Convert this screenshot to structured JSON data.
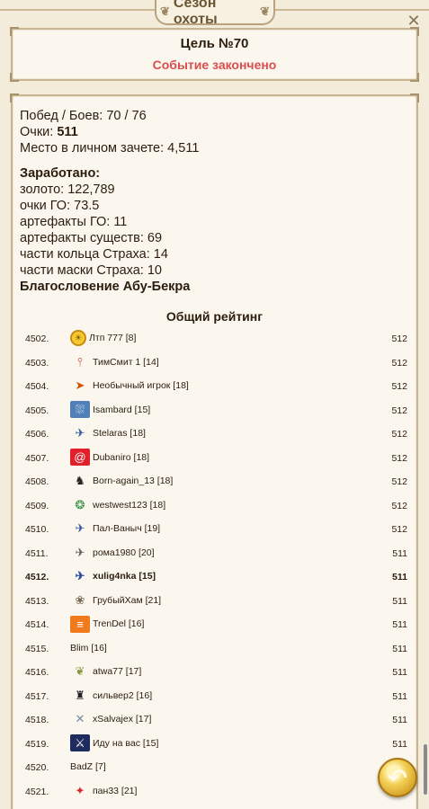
{
  "header": {
    "title": "Сезон охоты",
    "close_icon": "close-icon"
  },
  "goal": {
    "title": "Цель №70",
    "status": "Событие закончено"
  },
  "stats": {
    "wins_battles": "Побед / Боев: 70 / 76",
    "points_label": "Очки: ",
    "points_value": "511",
    "place": "Место в личном зачете: 4,511",
    "earned_title": "Заработано:",
    "gold": "золото: 122,789",
    "go_points": "очки ГО: 73.5",
    "go_artifacts": "артефакты ГО: 11",
    "creature_artifacts": "артефакты существ: 69",
    "ring_parts": "части кольца Страха: 14",
    "mask_parts": "части маски Страха: 10",
    "blessing": "Благословение Абу-Бекра"
  },
  "rating": {
    "title": "Общий рейтинг",
    "rows": [
      {
        "pos": "4502.",
        "name": "Лтп 777 [8]",
        "score": "512",
        "icon": "gold-coin-icon",
        "glyph": "☀",
        "bg": "",
        "fg": "#8a5500"
      },
      {
        "pos": "4503.",
        "name": "ТимСмит 1 [14]",
        "score": "512",
        "icon": "torch-icon",
        "glyph": "⫯",
        "bg": "",
        "fg": "#c0392b"
      },
      {
        "pos": "4504.",
        "name": "Необычный игрок [18]",
        "score": "512",
        "icon": "phoenix-icon",
        "glyph": "➤",
        "bg": "",
        "fg": "#d35400"
      },
      {
        "pos": "4505.",
        "name": "Isambard [15]",
        "score": "512",
        "icon": "blue-banner-icon",
        "glyph": "⛆",
        "bg": "#4f81b8",
        "fg": "#ffffff"
      },
      {
        "pos": "4506.",
        "name": "Stelaras [18]",
        "score": "512",
        "icon": "eagle-icon",
        "glyph": "✈",
        "bg": "",
        "fg": "#2b4f9e"
      },
      {
        "pos": "4507.",
        "name": "Dubaniro [18]",
        "score": "512",
        "icon": "at-sign-icon",
        "glyph": "@",
        "bg": "#e0202a",
        "fg": "#ffffff"
      },
      {
        "pos": "4508.",
        "name": "Born-again_13 [18]",
        "score": "512",
        "icon": "black-eagle-icon",
        "glyph": "♞",
        "bg": "",
        "fg": "#222222"
      },
      {
        "pos": "4509.",
        "name": "westwest123 [18]",
        "score": "512",
        "icon": "green-dragon-icon",
        "glyph": "❂",
        "bg": "",
        "fg": "#2e8b3a"
      },
      {
        "pos": "4510.",
        "name": "Пал-Ваныч [19]",
        "score": "512",
        "icon": "eagle-icon",
        "glyph": "✈",
        "bg": "",
        "fg": "#2b4f9e"
      },
      {
        "pos": "4511.",
        "name": "рома1980 [20]",
        "score": "511",
        "icon": "bird-icon",
        "glyph": "✈",
        "bg": "",
        "fg": "#555555"
      },
      {
        "pos": "4512.",
        "name": "xulig4nka [15]",
        "score": "511",
        "icon": "eagle-icon",
        "glyph": "✈",
        "bg": "",
        "fg": "#2b4f9e",
        "me": true
      },
      {
        "pos": "4513.",
        "name": "ГрубыйХам [21]",
        "score": "511",
        "icon": "cat-icon",
        "glyph": "❀",
        "bg": "",
        "fg": "#7a6a55"
      },
      {
        "pos": "4514.",
        "name": "TrenDel [16]",
        "score": "511",
        "icon": "orange-banner-icon",
        "glyph": "≡",
        "bg": "#f07a1e",
        "fg": "#ffffff"
      },
      {
        "pos": "4515.",
        "name": "Blim [16]",
        "score": "511",
        "icon": "",
        "glyph": "",
        "bg": "",
        "fg": ""
      },
      {
        "pos": "4516.",
        "name": "atwa77 [17]",
        "score": "511",
        "icon": "wings-icon",
        "glyph": "❦",
        "bg": "",
        "fg": "#8a9a4a"
      },
      {
        "pos": "4517.",
        "name": "сильвер2 [16]",
        "score": "511",
        "icon": "knights-icon",
        "glyph": "♜",
        "bg": "",
        "fg": "#222222"
      },
      {
        "pos": "4518.",
        "name": "xSalvajex [17]",
        "score": "511",
        "icon": "crossed-swords-icon",
        "glyph": "✕",
        "bg": "",
        "fg": "#7a8ba8"
      },
      {
        "pos": "4519.",
        "name": "Иду на вас [15]",
        "score": "511",
        "icon": "swords-icon",
        "glyph": "⚔",
        "bg": "#1d2b5e",
        "fg": "#ffffff"
      },
      {
        "pos": "4520.",
        "name": "BadZ [7]",
        "score": "511",
        "icon": "",
        "glyph": "",
        "bg": "",
        "fg": ""
      },
      {
        "pos": "4521.",
        "name": "пан33 [21]",
        "score": "511",
        "icon": "red-cross-icon",
        "glyph": "✦",
        "bg": "",
        "fg": "#d42a2a"
      }
    ]
  },
  "controls": {
    "back_icon": "back-arrow-icon",
    "back_glyph": "↶"
  },
  "colors": {
    "accent_red": "#d94f4f",
    "background": "#f3ecdb",
    "border": "#c7b491"
  }
}
